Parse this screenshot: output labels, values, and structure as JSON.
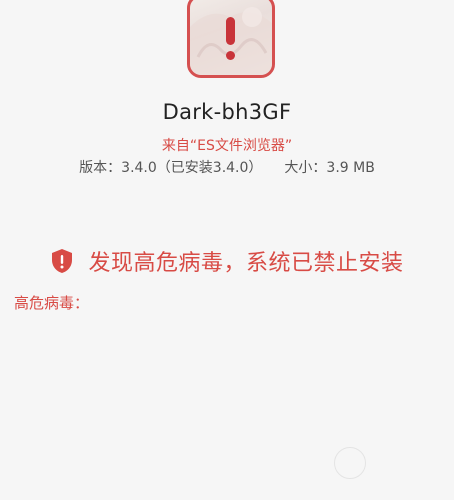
{
  "app": {
    "name": "Dark-bh3GF",
    "source": "来自“ES文件浏览器”",
    "version": "版本：3.4.0（已安装3.4.0）",
    "size": "大小：3.9 MB"
  },
  "warning": {
    "message": "发现高危病毒，系统已禁止安装",
    "virus_label": "高危病毒："
  },
  "icons": {
    "app_icon": "app-icon-with-alert",
    "shield": "shield-alert-icon"
  },
  "colors": {
    "danger": "#d84b45",
    "background": "#f6f6f6"
  }
}
